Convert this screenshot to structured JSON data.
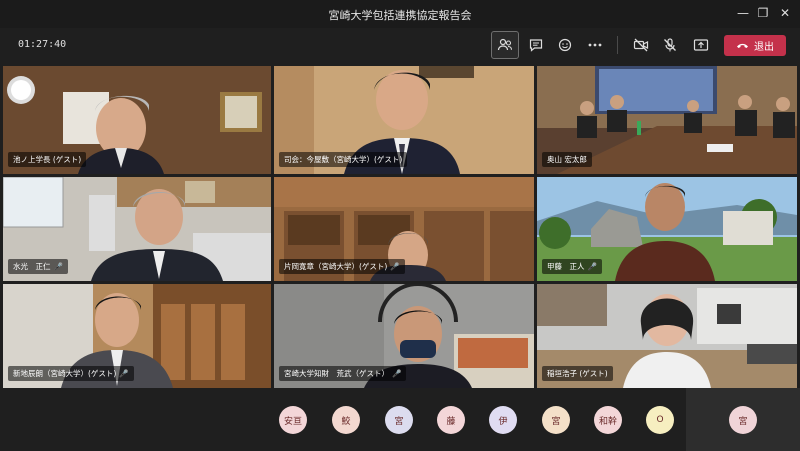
{
  "window": {
    "title": "宮崎大学包括連携協定報告会"
  },
  "toolbar": {
    "timer": "01:27:40",
    "leave_label": "退出",
    "icons": [
      "participants-icon",
      "chat-icon",
      "reactions-icon",
      "more-icon",
      "camera-off-icon",
      "mic-off-icon",
      "share-icon",
      "phone-icon"
    ]
  },
  "tiles": [
    {
      "name": "池ノ上学長 (ゲスト)",
      "muted": false
    },
    {
      "name": "司会：今屋敷（宮崎大学）(ゲスト)",
      "muted": false
    },
    {
      "name": "奥山 宏太郎",
      "muted": false
    },
    {
      "name": "水光　正仁",
      "muted": true
    },
    {
      "name": "片岡寛章（宮崎大学）(ゲスト)",
      "muted": true
    },
    {
      "name": "甲藤　正人",
      "muted": true
    },
    {
      "name": "新地辰朗（宮崎大学）(ゲスト)",
      "muted": true
    },
    {
      "name": "宮崎大学知財　荒武（ゲスト）",
      "muted": true
    },
    {
      "name": "稲垣浩子 (ゲスト)",
      "muted": false
    }
  ],
  "attendees": [
    {
      "initials": "安亘",
      "bg": "#f3d6d8"
    },
    {
      "initials": "鮫",
      "bg": "#f3d8d0"
    },
    {
      "initials": "宮",
      "bg": "#dcdcef"
    },
    {
      "initials": "藤",
      "bg": "#f3d6d8"
    },
    {
      "initials": "伊",
      "bg": "#e0dcf2"
    },
    {
      "initials": "宮",
      "bg": "#f4e0c8"
    },
    {
      "initials": "和幹",
      "bg": "#f3d6d8"
    },
    {
      "initials": "O",
      "bg": "#f6eec0"
    }
  ],
  "self_avatar": {
    "initials": "宮"
  },
  "colors": {
    "leave": "#c4314b",
    "background": "#1f1f1f"
  }
}
